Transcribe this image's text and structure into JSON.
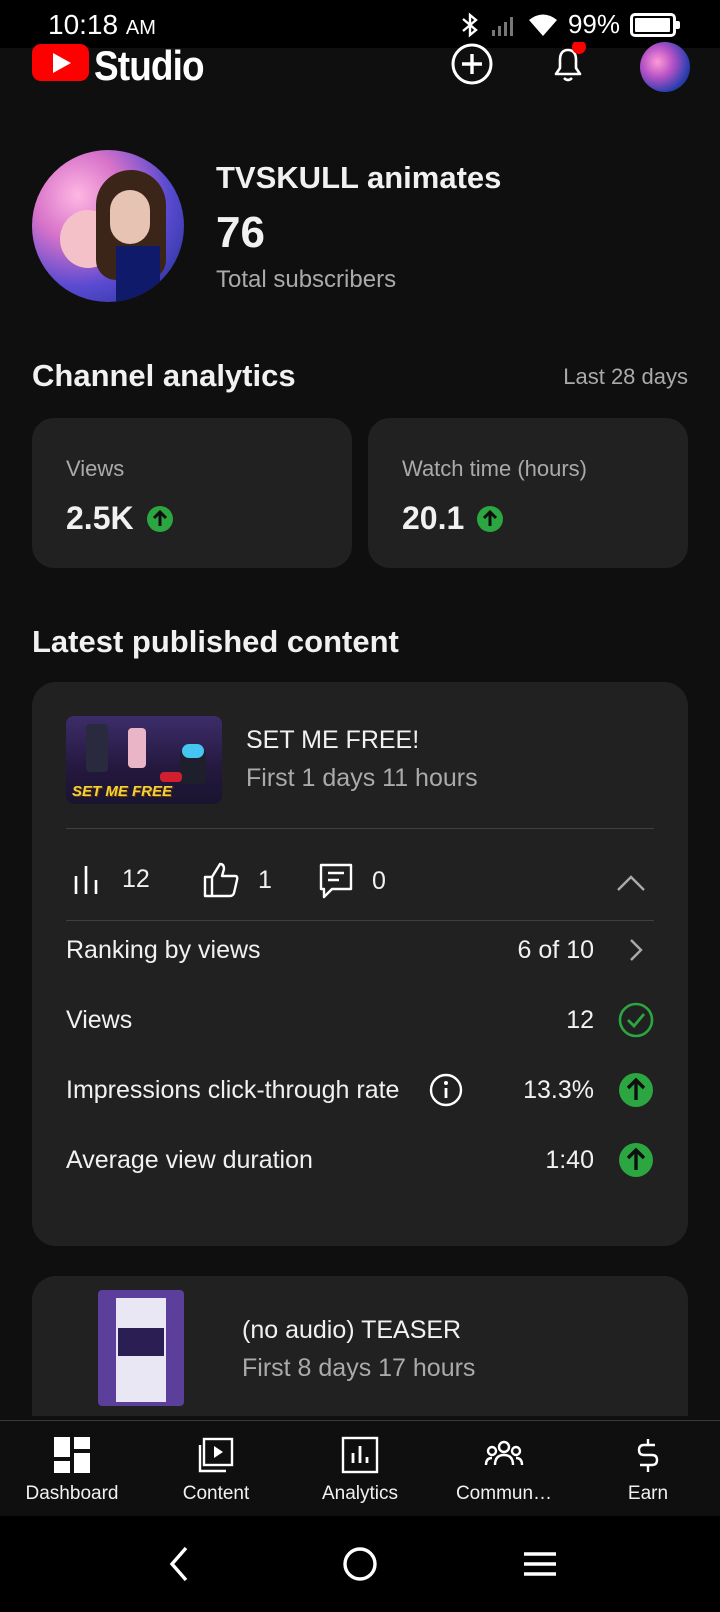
{
  "status_bar": {
    "time": "10:18",
    "ampm": "AM",
    "battery_text": "99%"
  },
  "header": {
    "app_name": "Studio",
    "notification_dot_color": "#ff0000"
  },
  "channel": {
    "name": "TVSKULL animates",
    "subscribers": "76",
    "subscribers_label": "Total subscribers"
  },
  "analytics": {
    "title": "Channel analytics",
    "period": "Last 28 days",
    "cards": [
      {
        "label": "Views",
        "value": "2.5K",
        "trend": "up"
      },
      {
        "label": "Watch time (hours)",
        "value": "20.1",
        "trend": "up"
      }
    ]
  },
  "latest": {
    "title": "Latest published content",
    "video": {
      "title": "SET ME FREE!",
      "age": "First 1 days 11 hours",
      "thumbnail_caption": "SET ME FREE",
      "views": "12",
      "likes": "1",
      "comments": "0",
      "details": [
        {
          "label": "Ranking by views",
          "value": "6 of 10",
          "icon": "chevron-right-icon"
        },
        {
          "label": "Views",
          "value": "12",
          "icon": "check-circle-icon"
        },
        {
          "label": "Impressions click-through rate",
          "value": "13.3%",
          "icon": "arrow-up-circle-icon"
        },
        {
          "label": "Average view duration",
          "value": "1:40",
          "icon": "arrow-up-circle-icon"
        }
      ]
    },
    "video2": {
      "title": "(no audio) TEASER",
      "age": "First 8 days 17 hours"
    }
  },
  "bottom_nav": [
    {
      "label": "Dashboard",
      "icon": "dashboard-icon"
    },
    {
      "label": "Content",
      "icon": "content-icon"
    },
    {
      "label": "Analytics",
      "icon": "analytics-icon"
    },
    {
      "label": "Commun…",
      "icon": "community-icon"
    },
    {
      "label": "Earn",
      "icon": "earn-icon"
    }
  ],
  "colors": {
    "accent_green": "#2ba640",
    "card_bg": "#212121",
    "bg": "#0f0f0f",
    "secondary_text": "#aaaaaa"
  }
}
